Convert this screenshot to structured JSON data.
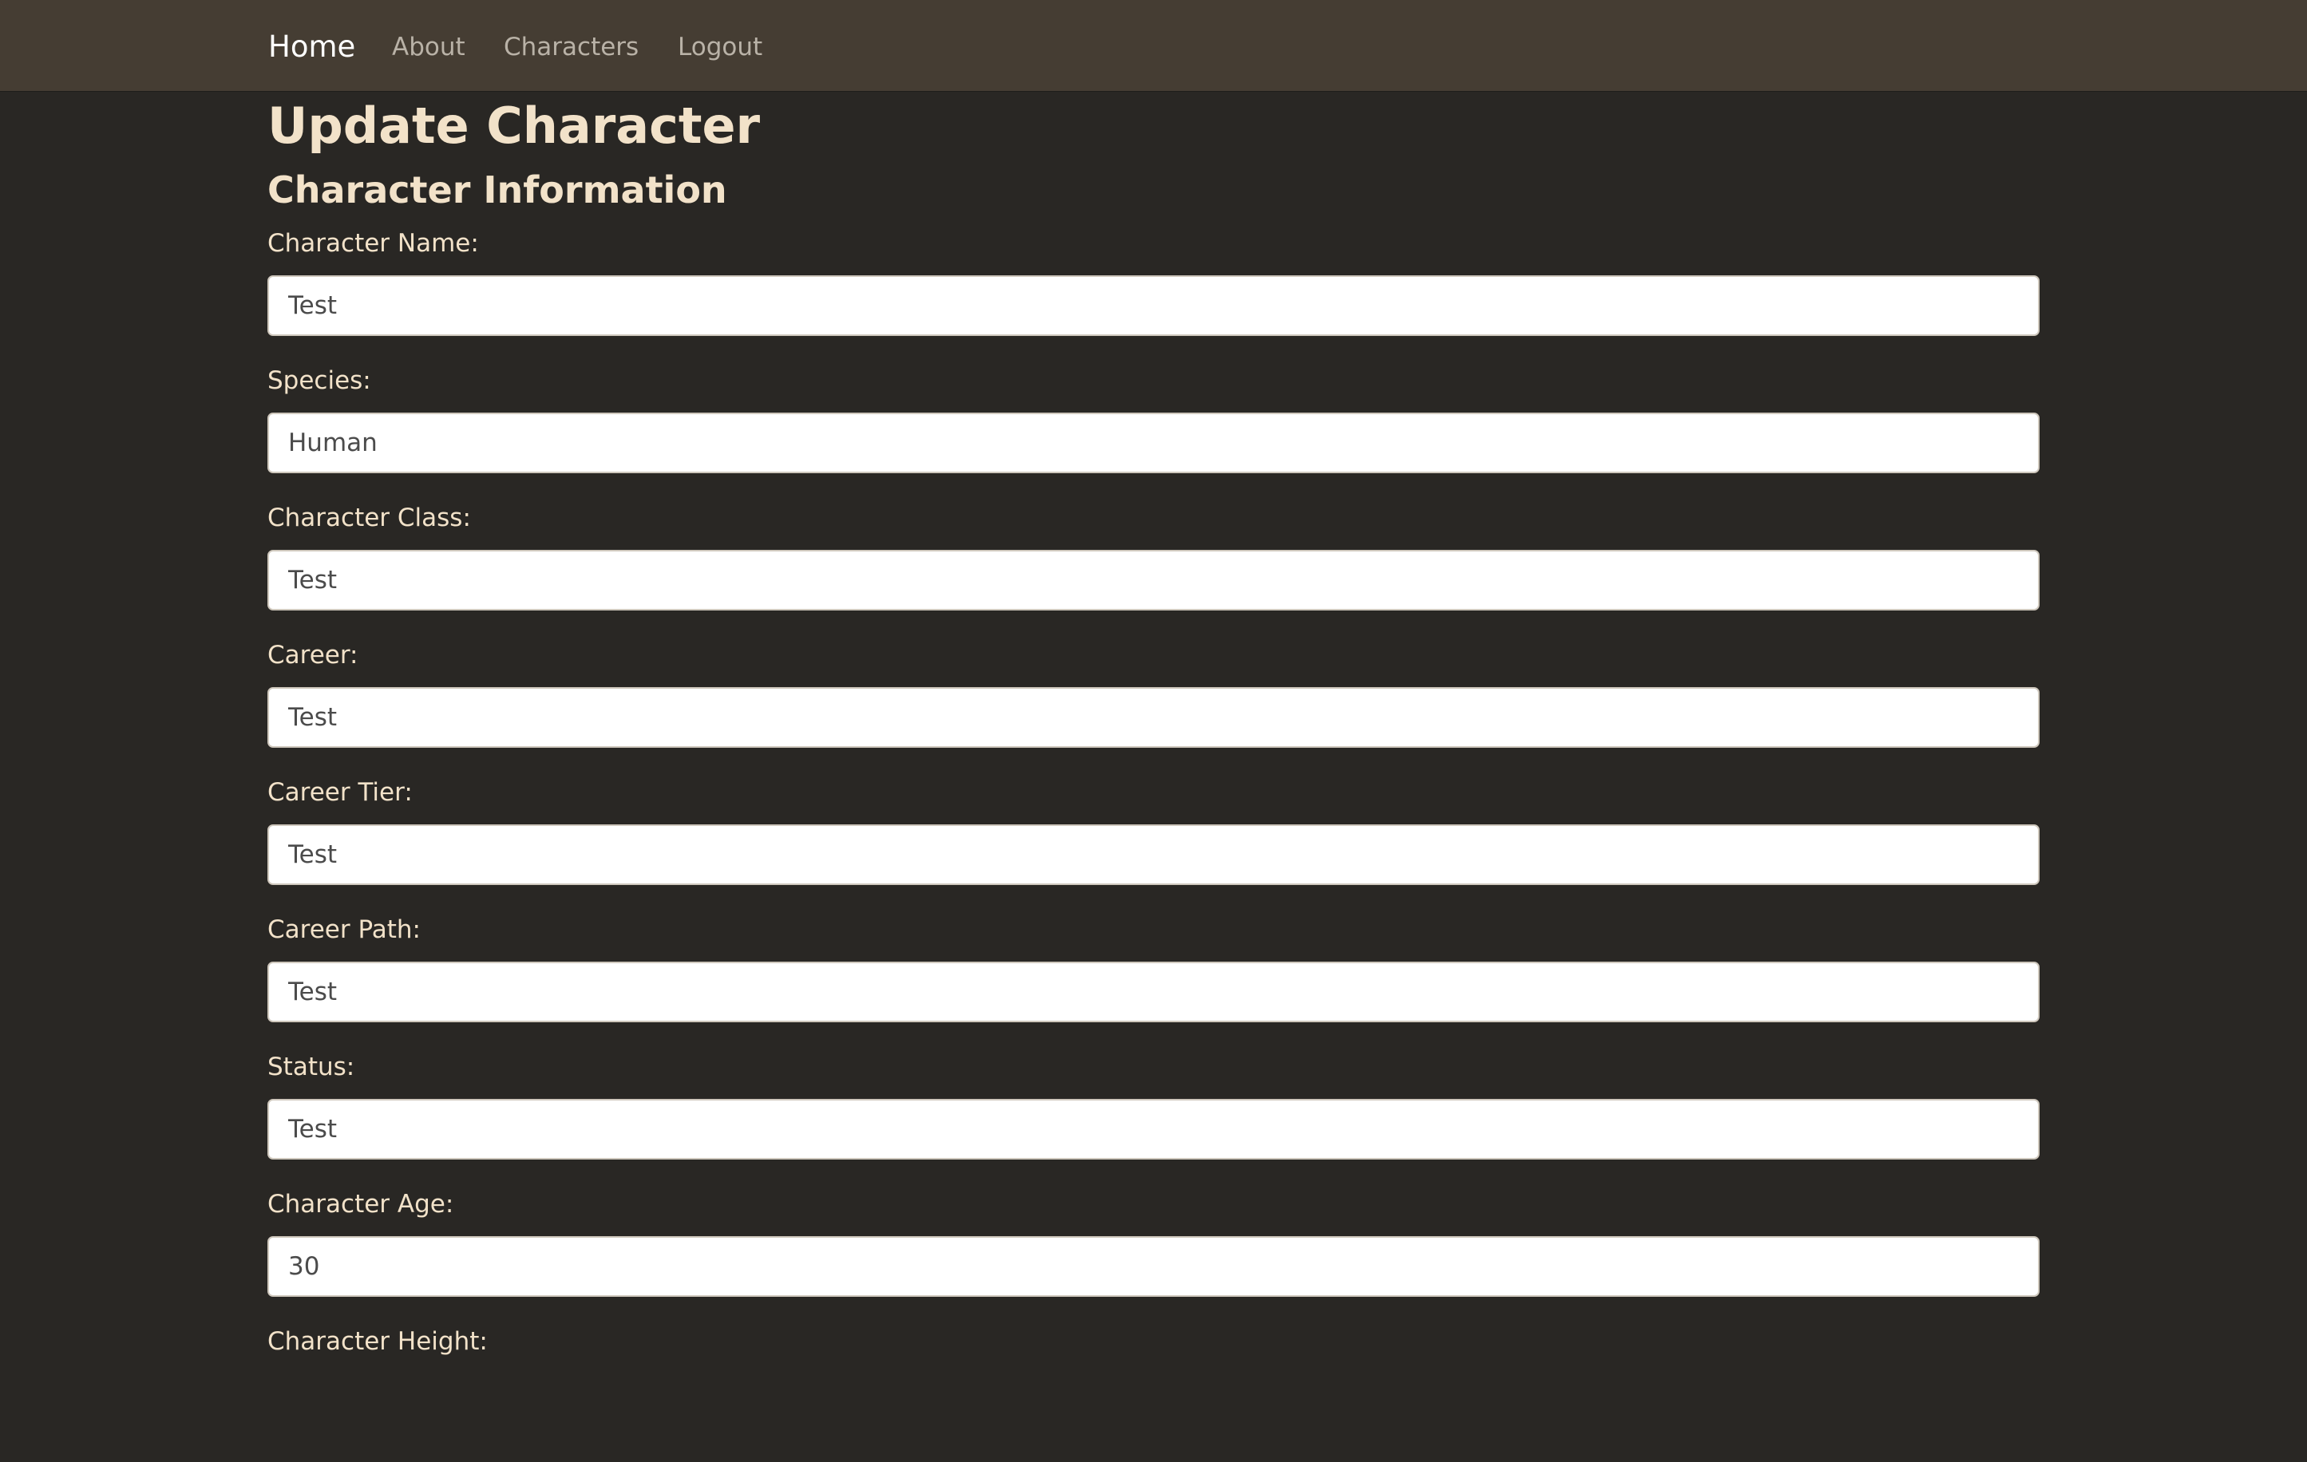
{
  "nav": {
    "brand": "Home",
    "links": [
      "About",
      "Characters",
      "Logout"
    ]
  },
  "page": {
    "title": "Update Character",
    "section_title": "Character Information"
  },
  "form": {
    "fields": [
      {
        "label": "Character Name:",
        "value": "Test"
      },
      {
        "label": "Species:",
        "value": "Human"
      },
      {
        "label": "Character Class:",
        "value": "Test"
      },
      {
        "label": "Career:",
        "value": "Test"
      },
      {
        "label": "Career Tier:",
        "value": "Test"
      },
      {
        "label": "Career Path:",
        "value": "Test"
      },
      {
        "label": "Status:",
        "value": "Test"
      },
      {
        "label": "Character Age:",
        "value": "30"
      },
      {
        "label": "Character Height:",
        "value": ""
      }
    ]
  },
  "colors": {
    "navbar_bg": "#453d33",
    "page_bg": "#292724",
    "heading_text": "#f2e2c9",
    "nav_link_text": "#b9b2a7"
  }
}
